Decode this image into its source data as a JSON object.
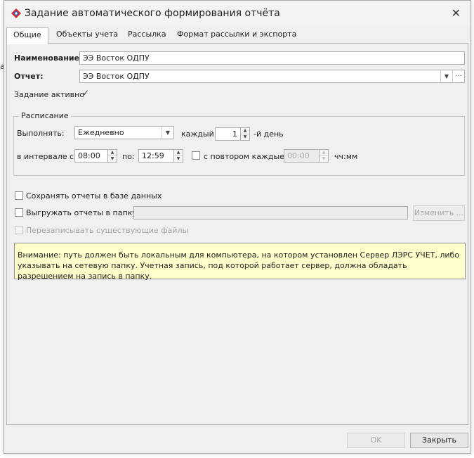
{
  "window": {
    "title": "Задание автоматического формирования отчёта",
    "app_icon": "diamond-logo-icon",
    "close_icon": "close-icon"
  },
  "tabs": [
    {
      "label": "Общие",
      "active": true
    },
    {
      "label": "Объекты учета"
    },
    {
      "label": "Рассылка"
    },
    {
      "label": "Формат рассылки и экспорта"
    }
  ],
  "general": {
    "name_label": "Наименование:",
    "name_value": "ЭЭ Восток ОДПУ",
    "report_label": "Отчет:",
    "report_value": "ЭЭ Восток ОДПУ",
    "report_more": "···",
    "active_label": "Задание активно",
    "active_checked": true
  },
  "schedule": {
    "title": "Расписание",
    "run_label": "Выполнять:",
    "run_value": "Ежедневно",
    "every_label": "каждый",
    "every_value": "1",
    "day_suffix": "-й день",
    "interval_label": "в интервале с:",
    "from_value": "08:00",
    "to_label": "по:",
    "to_value": "12:59",
    "repeat_label": "с повтором каждые:",
    "repeat_value": "00:00",
    "repeat_unit": "чч:мм"
  },
  "storage": {
    "save_db_label": "Сохранять отчеты в базе данных",
    "export_label": "Выгружать отчеты в папку:",
    "export_path": "",
    "change_button": "Изменить ...",
    "overwrite_label": "Перезаписывать существующие файлы"
  },
  "notice": {
    "text": "Внимание: путь должен быть локальным для компьютера, на котором установлен Сервер ЛЭРС УЧЕТ, либо указывать на сетевую папку. Учетная запись, под которой работает сервер, должна обладать разрешением на запись в папку."
  },
  "footer": {
    "ok_label": "OK",
    "close_label": "Закрыть"
  },
  "background": {
    "left_edge_fragment": "а"
  }
}
